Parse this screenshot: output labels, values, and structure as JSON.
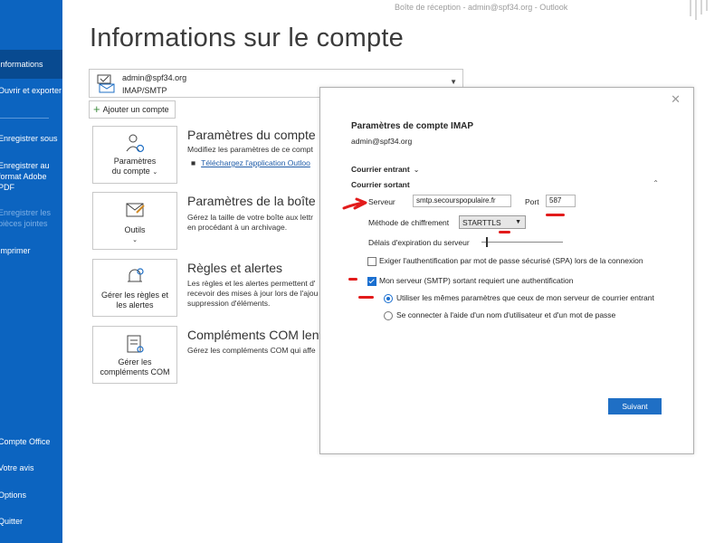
{
  "titlebar": {
    "text": "Boîte de réception - admin@spf34.org  -  Outlook"
  },
  "sidebar": {
    "items": [
      {
        "label": "Informations"
      },
      {
        "label": "Ouvrir et exporter"
      },
      {
        "label": "Enregistrer sous"
      },
      {
        "label": "Enregistrer au format Adobe PDF"
      },
      {
        "label": "Enregistrer les pièces jointes"
      },
      {
        "label": "Imprimer"
      },
      {
        "label": "Compte Office"
      },
      {
        "label": "Votre avis"
      },
      {
        "label": "Options"
      },
      {
        "label": "Quitter"
      }
    ]
  },
  "main": {
    "title": "Informations sur le compte",
    "account": {
      "email": "admin@spf34.org",
      "type": "IMAP/SMTP"
    },
    "add_account": "Ajouter un compte",
    "sections": [
      {
        "card_label_1": "Paramètres",
        "card_label_2": "du compte",
        "title": "Paramètres du compte",
        "desc_1": "Modifiez les paramètres de ce compt",
        "link": "Téléchargez l'application Outloo"
      },
      {
        "card_label_1": "Outils",
        "title": "Paramètres de la boîte au",
        "desc_1": "Gérez la taille de votre boîte aux lettr",
        "desc_2": "en procédant à un archivage."
      },
      {
        "card_label_1": "Gérer les règles et",
        "card_label_2": "les alertes",
        "title": "Règles et alertes",
        "desc_1": "Les règles et les alertes permettent d'",
        "desc_2": "recevoir des mises à jour lors de l'ajou",
        "desc_3": "suppression d'éléments."
      },
      {
        "card_label_1": "Gérer les",
        "card_label_2": "compléments COM",
        "title": "Compléments COM lents",
        "desc_1": "Gérez les compléments COM qui affe"
      }
    ]
  },
  "dialog": {
    "close": "✕",
    "title": "Paramètres de compte IMAP",
    "email": "admin@spf34.org",
    "incoming": "Courrier entrant",
    "outgoing": "Courrier sortant",
    "server_label": "Serveur",
    "server_value": "smtp.secourspopulaire.fr",
    "port_label": "Port",
    "port_value": "587",
    "encryption_label": "Méthode de chiffrement",
    "encryption_value": "STARTTLS",
    "timeout_label": "Délais d'expiration du serveur",
    "spa_label": "Exiger l'authentification par mot de passe sécurisé (SPA) lors de la connexion",
    "spa_checked": false,
    "auth_label": "Mon serveur (SMTP) sortant requiert une authentification",
    "auth_checked": true,
    "radio_same": "Utiliser les mêmes paramètres que ceux de mon serveur de courrier entrant",
    "radio_other": "Se connecter à l'aide d'un nom d'utilisateur et d'un mot de passe",
    "next_button": "Suivant"
  },
  "colors": {
    "sidebar": "#0c64c0",
    "accent": "#1f6fc5",
    "annotation": "#e21b1b"
  }
}
